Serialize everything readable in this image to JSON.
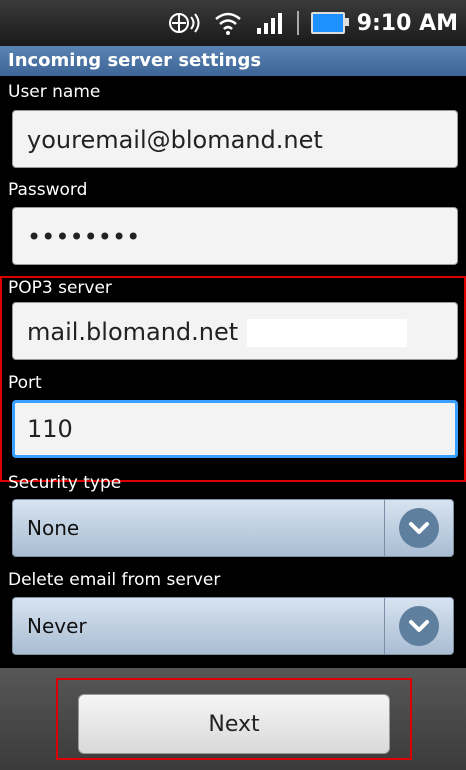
{
  "status": {
    "time": "9:10 AM",
    "icons": [
      "data-sync-icon",
      "wifi-icon",
      "signal-icon",
      "battery-icon"
    ]
  },
  "title": "Incoming server settings",
  "fields": {
    "username": {
      "label": "User name",
      "value": "youremail@blomand.net"
    },
    "password": {
      "label": "Password",
      "value": "••••••••"
    },
    "pop3": {
      "label": "POP3 server",
      "value": "mail.blomand.net"
    },
    "port": {
      "label": "Port",
      "value": "110"
    }
  },
  "selects": {
    "security": {
      "label": "Security type",
      "value": "None"
    },
    "delete_email": {
      "label": "Delete email from server",
      "value": "Never"
    }
  },
  "actions": {
    "next_label": "Next"
  },
  "colors": {
    "accent": "#3aa0ff",
    "title_bar": "#4b76a7",
    "highlight_box": "#d00000"
  }
}
